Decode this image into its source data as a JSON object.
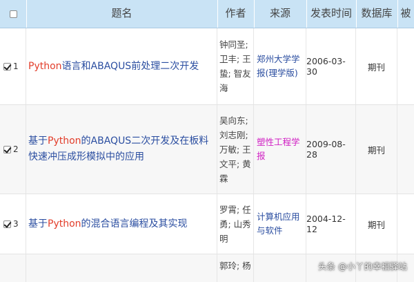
{
  "header": {
    "columns": [
      "题名",
      "作者",
      "来源",
      "发表时间",
      "数据库",
      "被"
    ]
  },
  "rows": [
    {
      "index": "1",
      "checked": true,
      "title_parts": [
        {
          "text": "Python",
          "kw": true
        },
        {
          "text": "语言和ABAQUS前处理二次开发",
          "kw": false
        }
      ],
      "authors": [
        "钟同圣;",
        "卫丰; 王",
        "蛰; 智友",
        "海"
      ],
      "source": [
        "郑州大学学",
        "报(理学版)"
      ],
      "date": "2006-03-30",
      "database": "期刊"
    },
    {
      "index": "2",
      "checked": true,
      "title_parts": [
        {
          "text": "基于",
          "kw": false
        },
        {
          "text": "Python",
          "kw": true
        },
        {
          "text": "的ABAQUS二次开发及在板料快速冲压成形模拟中的应用",
          "kw": false
        }
      ],
      "authors": [
        "吴向东;",
        "刘志刚;",
        "万敏; 王",
        "文平; 黄",
        "霖"
      ],
      "source": [
        "塑性工程学",
        "报"
      ],
      "date": "2009-08-28",
      "database": "期刊"
    },
    {
      "index": "3",
      "checked": true,
      "title_parts": [
        {
          "text": "基于",
          "kw": false
        },
        {
          "text": "Python",
          "kw": true
        },
        {
          "text": "的混合语言编程及其实现",
          "kw": false
        }
      ],
      "authors": [
        "罗霄; 任",
        "勇; 山秀",
        "明"
      ],
      "source": [
        "计算机应用",
        "与软件"
      ],
      "date": "2004-12-12",
      "database": "期刊"
    },
    {
      "index": "",
      "checked": false,
      "title_parts": [],
      "authors": [
        "郭玲; 杨"
      ],
      "source": [],
      "date": "",
      "database": ""
    }
  ],
  "watermark": "头条 @小丫的幸福驿站",
  "colors": {
    "header_bg": "#c9e3f5",
    "title_link": "#2a4da0",
    "keyword": "#e23d2a",
    "source_magenta": "#d01fc3"
  }
}
